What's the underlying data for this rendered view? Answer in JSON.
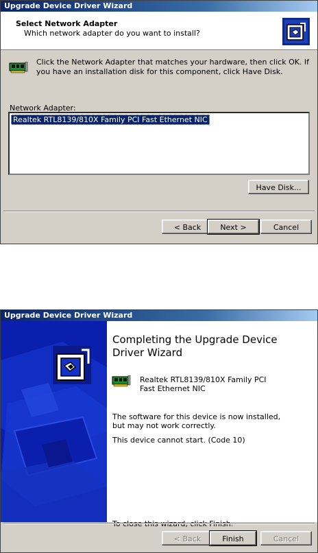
{
  "window1": {
    "title": "Upgrade Device Driver Wizard",
    "header_title": "Select Network Adapter",
    "header_subtitle": "Which network adapter do you want to install?",
    "instructions": "Click the Network Adapter that matches your hardware, then click OK. If you have an installation disk for this component, click Have Disk.",
    "list_label": "Network Adapter:",
    "list_items": [
      "Realtek RTL8139/810X Family PCI Fast Ethernet NIC"
    ],
    "have_disk_label": "Have Disk...",
    "back_label": "< Back",
    "next_label": "Next >",
    "cancel_label": "Cancel"
  },
  "window2": {
    "title": "Upgrade Device Driver Wizard",
    "heading": "Completing the Upgrade Device Driver Wizard",
    "device_name": "Realtek RTL8139/810X Family PCI Fast Ethernet NIC",
    "message1": "The software for this device is now installed, but may not work correctly.",
    "message2": "This device cannot start. (Code 10)",
    "close_instruction": "To close this wizard, click Finish.",
    "back_label": "< Back",
    "finish_label": "Finish",
    "cancel_label": "Cancel"
  },
  "colors": {
    "title_bar": "#0a246a",
    "side_panel": "#0b1fae",
    "selection": "#0a246a",
    "dialog_face": "#d4d0c8"
  },
  "icons": [
    "network-adapter-icon",
    "wizard-hardware-icon"
  ]
}
